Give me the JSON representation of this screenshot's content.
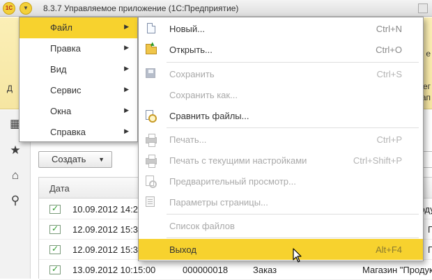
{
  "window": {
    "title": "8.3.7 Управляемое приложение  (1С:Предприятие)",
    "logo_text": "1С"
  },
  "background": {
    "right_band_text_1": "е",
    "right_band_text_2": "ег",
    "right_band_text_3": "ап",
    "left_band_text": "Д",
    "create_label": "Создать",
    "search_text": "а",
    "grid": {
      "header_date": "Дата",
      "rows": [
        {
          "date": "10.09.2012 14:2",
          "number": "",
          "type": "",
          "client": "Проду"
        },
        {
          "date": "12.09.2012 15:30",
          "number": "",
          "type": "",
          "client": "П"
        },
        {
          "date": "12.09.2012 15:30",
          "number": "",
          "type": "",
          "client": "П"
        },
        {
          "date": "13.09.2012 10:15:00",
          "number": "000000018",
          "type": "Заказ",
          "client": "Магазин \"Продук"
        }
      ]
    }
  },
  "main_menu": {
    "items": [
      {
        "label": "Файл",
        "active": true
      },
      {
        "label": "Правка",
        "active": false
      },
      {
        "label": "Вид",
        "active": false
      },
      {
        "label": "Сервис",
        "active": false
      },
      {
        "label": "Окна",
        "active": false
      },
      {
        "label": "Справка",
        "active": false
      }
    ]
  },
  "file_menu": {
    "items": [
      {
        "label": "Новый...",
        "shortcut": "Ctrl+N",
        "icon": "new-document-icon",
        "enabled": true
      },
      {
        "label": "Открыть...",
        "shortcut": "Ctrl+O",
        "icon": "open-folder-icon",
        "enabled": true
      },
      {
        "label": "Сохранить",
        "shortcut": "Ctrl+S",
        "icon": "save-disk-icon",
        "enabled": false
      },
      {
        "label": "Сохранить как...",
        "shortcut": "",
        "icon": "",
        "enabled": false
      },
      {
        "label": "Сравнить файлы...",
        "shortcut": "",
        "icon": "compare-files-icon",
        "enabled": true
      },
      {
        "label": "Печать...",
        "shortcut": "Ctrl+P",
        "icon": "printer-icon",
        "enabled": false
      },
      {
        "label": "Печать с текущими настройками",
        "shortcut": "Ctrl+Shift+P",
        "icon": "quick-print-icon",
        "enabled": false
      },
      {
        "label": "Предварительный просмотр...",
        "shortcut": "",
        "icon": "print-preview-icon",
        "enabled": false
      },
      {
        "label": "Параметры страницы...",
        "shortcut": "",
        "icon": "page-setup-icon",
        "enabled": false
      },
      {
        "label": "Список файлов",
        "shortcut": "",
        "icon": "",
        "enabled": false
      },
      {
        "label": "Выход",
        "shortcut": "Alt+F4",
        "icon": "",
        "enabled": true,
        "highlighted": true
      }
    ]
  },
  "colors": {
    "highlight": "#f7d22e",
    "band": "#fbefb6",
    "disabled_text": "#a9a9a9"
  }
}
